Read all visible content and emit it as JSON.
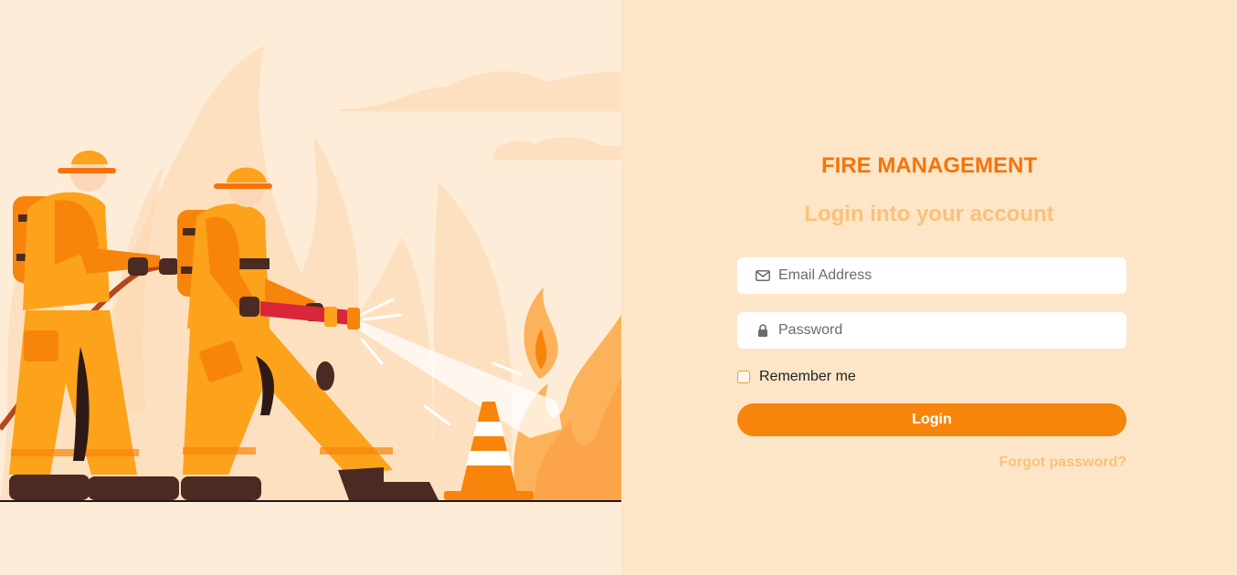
{
  "brand": {
    "title": "FIRE MANAGEMENT",
    "subtitle": "Login into your account"
  },
  "form": {
    "email": {
      "placeholder": "Email Address",
      "value": "",
      "icon": "envelope-icon"
    },
    "password": {
      "placeholder": "Password",
      "value": "",
      "icon": "lock-icon"
    },
    "remember_label": "Remember me",
    "remember_checked": false,
    "login_label": "Login",
    "forgot_label": "Forgot password?"
  },
  "colors": {
    "accent": "#f7850b",
    "brand_text": "#f5730d",
    "muted_orange": "#fbc07a",
    "panel_bg": "#fde6c7",
    "illustration_bg": "#fdecd8"
  },
  "illustration": {
    "subject": "two firefighters spraying water at a fire with a traffic cone"
  }
}
